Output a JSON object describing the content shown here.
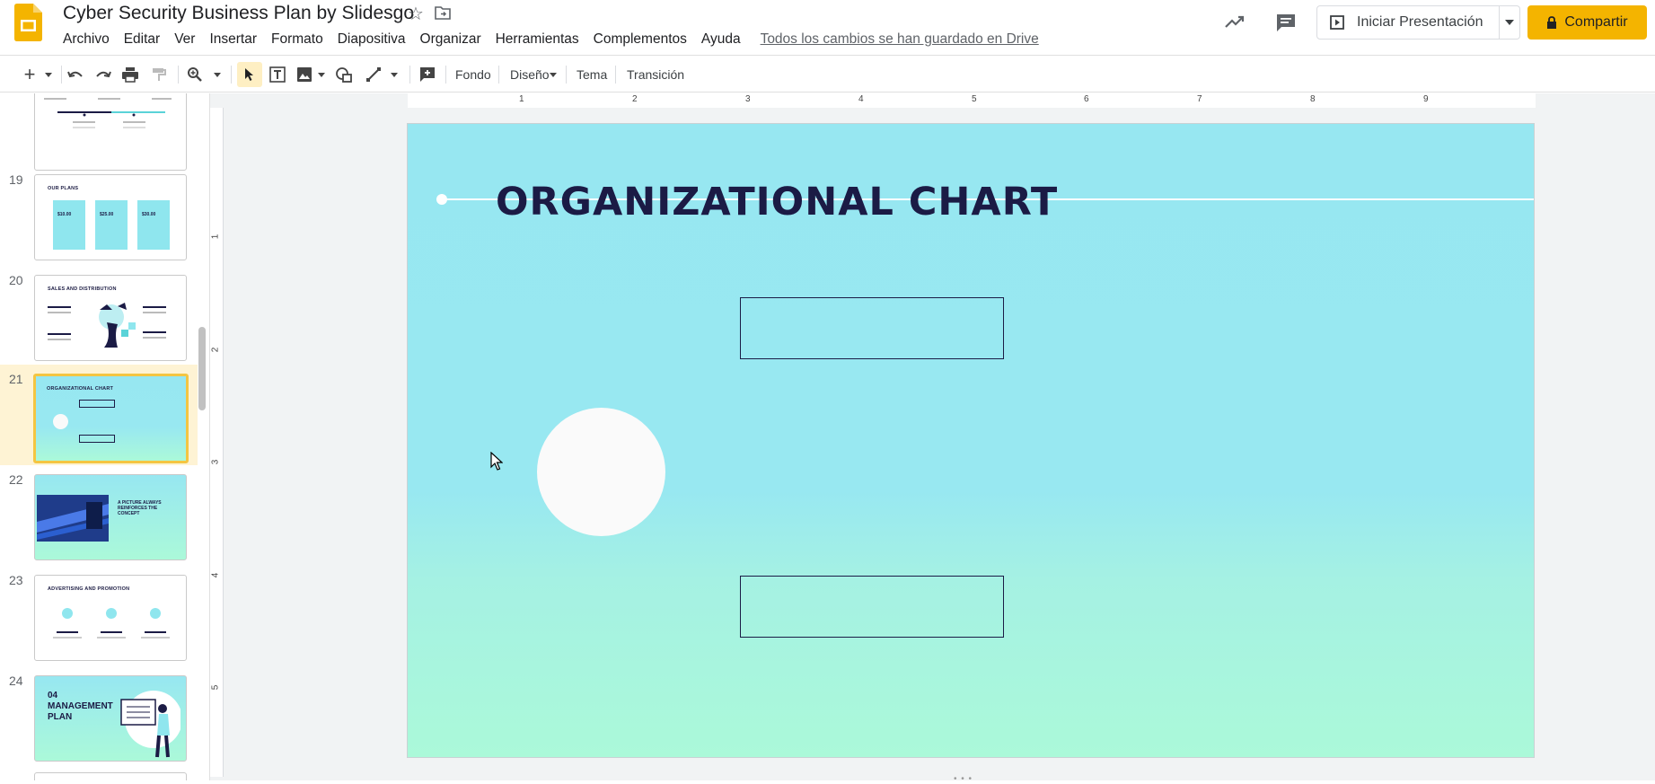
{
  "app": {
    "doc_title": "Cyber Security Business Plan by Slidesgo",
    "save_status": "Todos los cambios se han guardado en Drive",
    "present_label": "Iniciar Presentación",
    "share_label": "Compartir",
    "accent_color": "#f4b400",
    "icons": [
      "slides-logo-icon",
      "star-icon",
      "move-folder-icon",
      "activity-trend-icon",
      "comment-icon",
      "present-play-icon",
      "lock-icon"
    ]
  },
  "menu": [
    "Archivo",
    "Editar",
    "Ver",
    "Insertar",
    "Formato",
    "Diapositiva",
    "Organizar",
    "Herramientas",
    "Complementos",
    "Ayuda"
  ],
  "toolbar": {
    "background_label": "Fondo",
    "layout_label": "Diseño",
    "theme_label": "Tema",
    "transition_label": "Transición"
  },
  "filmstrip": {
    "slides": [
      {
        "number": "19",
        "label": "OUR PLANS"
      },
      {
        "number": "20",
        "label": "SALES AND DISTRIBUTION"
      },
      {
        "number": "21",
        "label": "ORGANIZATIONAL CHART"
      },
      {
        "number": "22",
        "label": "A PICTURE ALWAYS REINFORCES THE CONCEPT"
      },
      {
        "number": "23",
        "label": "ADVERTISING AND PROMOTION"
      },
      {
        "number": "24",
        "label": "04 MANAGEMENT PLAN"
      }
    ],
    "selected_number": "21",
    "slide19_prices": [
      "$10.00",
      "$25.00",
      "$30.00"
    ]
  },
  "ruler": {
    "top": [
      "1",
      "2",
      "3",
      "4",
      "5",
      "6",
      "7",
      "8",
      "9"
    ],
    "left": [
      "1",
      "2",
      "3",
      "4",
      "5"
    ]
  },
  "slide": {
    "title": "ORGANIZATIONAL CHART"
  }
}
